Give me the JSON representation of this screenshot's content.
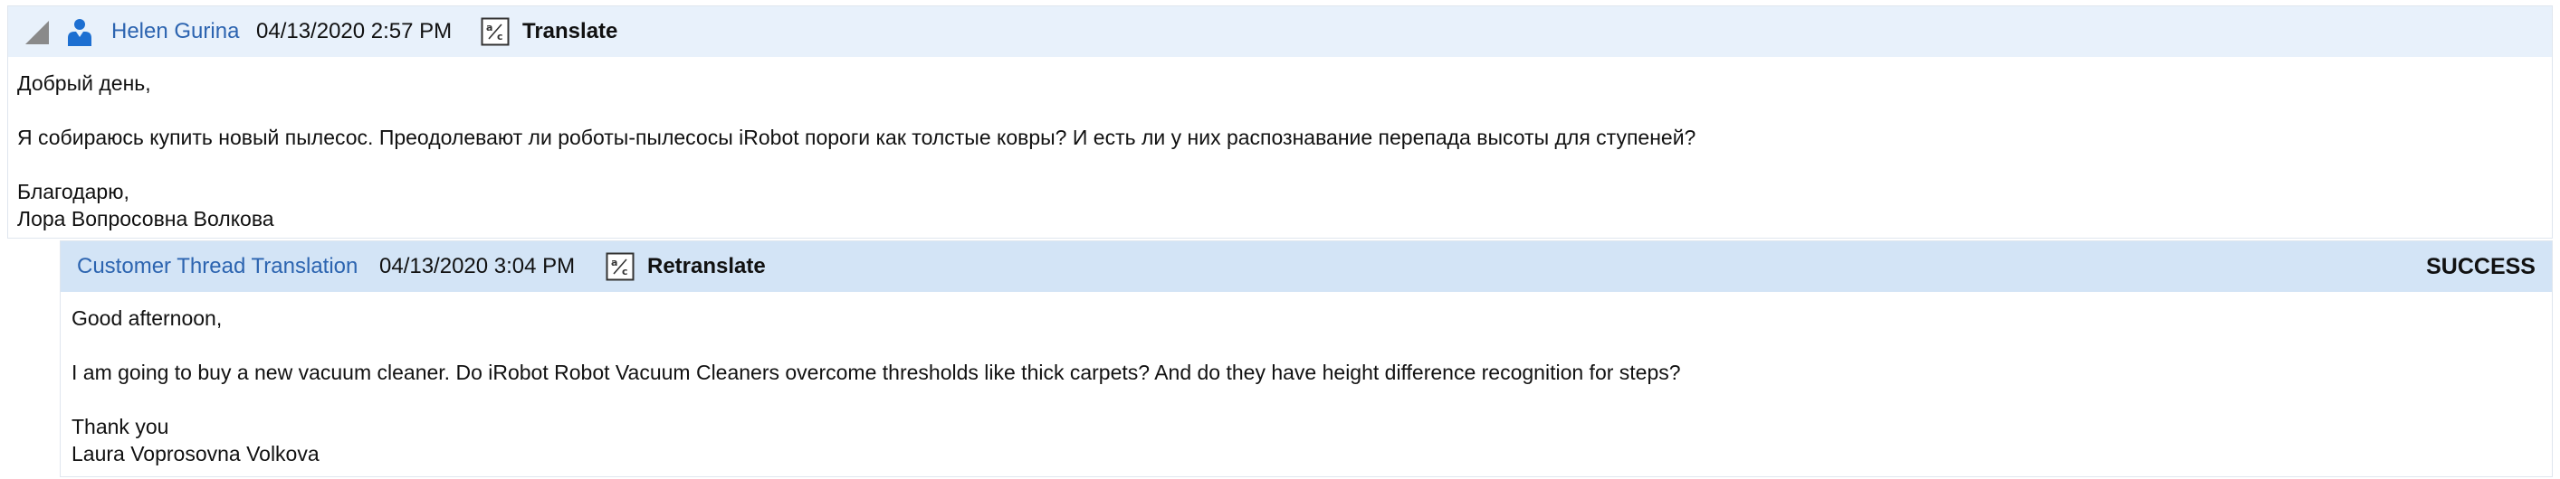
{
  "original": {
    "author": "Helen Gurina",
    "timestamp": "04/13/2020 2:57 PM",
    "action_label": "Translate",
    "icons": {
      "collapse": "collapse-triangle-icon",
      "user": "user-icon",
      "translate": "translate-icon"
    },
    "body": {
      "greeting": "Добрый день,",
      "paragraph": "Я собираюсь купить новый пылесос. Преодолевают ли роботы-пылесосы iRobot пороги как толстые ковры? И есть ли у них распознавание перепада высоты для ступеней?",
      "closing": "Благодарю,",
      "signature": "Лора Вопросовна Волкова"
    }
  },
  "translation": {
    "author": "Customer Thread Translation",
    "timestamp": "04/13/2020 3:04 PM",
    "action_label": "Retranslate",
    "status": "SUCCESS",
    "icons": {
      "translate": "translate-icon"
    },
    "body": {
      "greeting": "Good afternoon,",
      "paragraph": "I am going to buy a new vacuum cleaner. Do iRobot Robot Vacuum Cleaners overcome thresholds like thick carpets? And do they have height difference recognition for steps?",
      "closing": "Thank you",
      "signature": "Laura Voprosovna Volkova"
    }
  },
  "colors": {
    "header_original": "#e8f1fb",
    "header_translation": "#d3e4f6",
    "link": "#2c64b0",
    "icon_blue": "#1d6fd1"
  }
}
